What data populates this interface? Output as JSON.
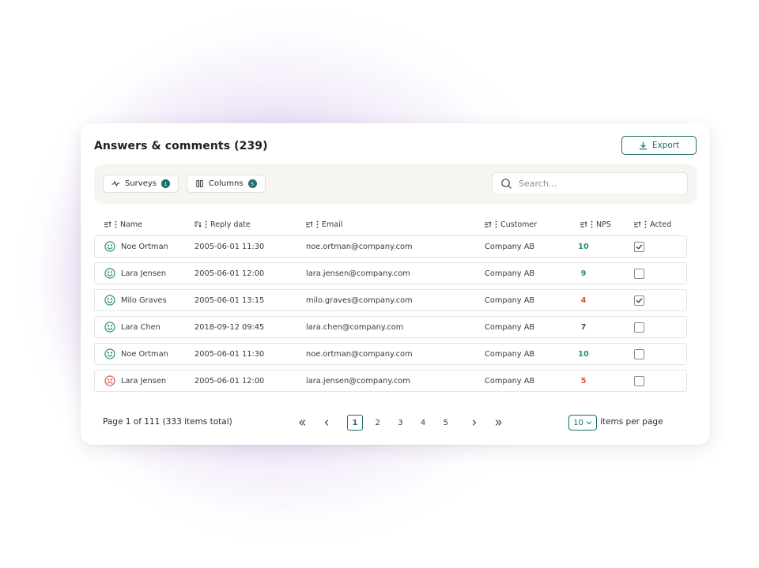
{
  "title": "Answers & comments (239)",
  "export_label": "Export",
  "toolbar": {
    "surveys_label": "Surveys",
    "surveys_count": "1",
    "columns_label": "Columns",
    "columns_count": "5",
    "search_placeholder": "Search..."
  },
  "columns": {
    "name": "Name",
    "reply_date": "Reply date",
    "email": "Email",
    "customer": "Customer",
    "nps": "NPS",
    "acted": "Acted"
  },
  "rows": [
    {
      "sentiment": "happy",
      "name": "Noe Ortman",
      "date": "2005-06-01 11:30",
      "email": "noe.ortman@company.com",
      "customer": "Company AB",
      "nps": "10",
      "nps_color": "#2a8f73",
      "acted": true
    },
    {
      "sentiment": "happy",
      "name": "Lara Jensen",
      "date": "2005-06-01 12:00",
      "email": "lara.jensen@company.com",
      "customer": "Company AB",
      "nps": "9",
      "nps_color": "#2a8f73",
      "acted": false
    },
    {
      "sentiment": "happy",
      "name": "Milo Graves",
      "date": "2005-06-01 13:15",
      "email": "milo.graves@company.com",
      "customer": "Company AB",
      "nps": "4",
      "nps_color": "#d9534f",
      "acted": true
    },
    {
      "sentiment": "happy",
      "name": "Lara Chen",
      "date": "2018-09-12 09:45",
      "email": "lara.chen@company.com",
      "customer": "Company AB",
      "nps": "7",
      "nps_color": "#555555",
      "acted": false
    },
    {
      "sentiment": "happy",
      "name": "Noe Ortman",
      "date": "2005-06-01 11:30",
      "email": "noe.ortman@company.com",
      "customer": "Company AB",
      "nps": "10",
      "nps_color": "#2a8f73",
      "acted": false
    },
    {
      "sentiment": "sad",
      "name": "Lara Jensen",
      "date": "2005-06-01 12:00",
      "email": "lara.jensen@company.com",
      "customer": "Company AB",
      "nps": "5",
      "nps_color": "#d9534f",
      "acted": false
    }
  ],
  "footer": {
    "page_info": "Page 1 of 111 (333 items total)",
    "pages": [
      "1",
      "2",
      "3",
      "4",
      "5"
    ],
    "current_page": "1",
    "per_page_value": "10",
    "per_page_label": "items per page"
  },
  "colors": {
    "accent": "#1d6f6a",
    "happy": "#2a8f73",
    "sad": "#d9534f"
  },
  "icons": {
    "surveys": "activity-icon",
    "columns": "columns-icon",
    "search": "search-icon",
    "export": "download-icon",
    "sort": "sort-icon",
    "column_menu": "kebab-icon"
  }
}
